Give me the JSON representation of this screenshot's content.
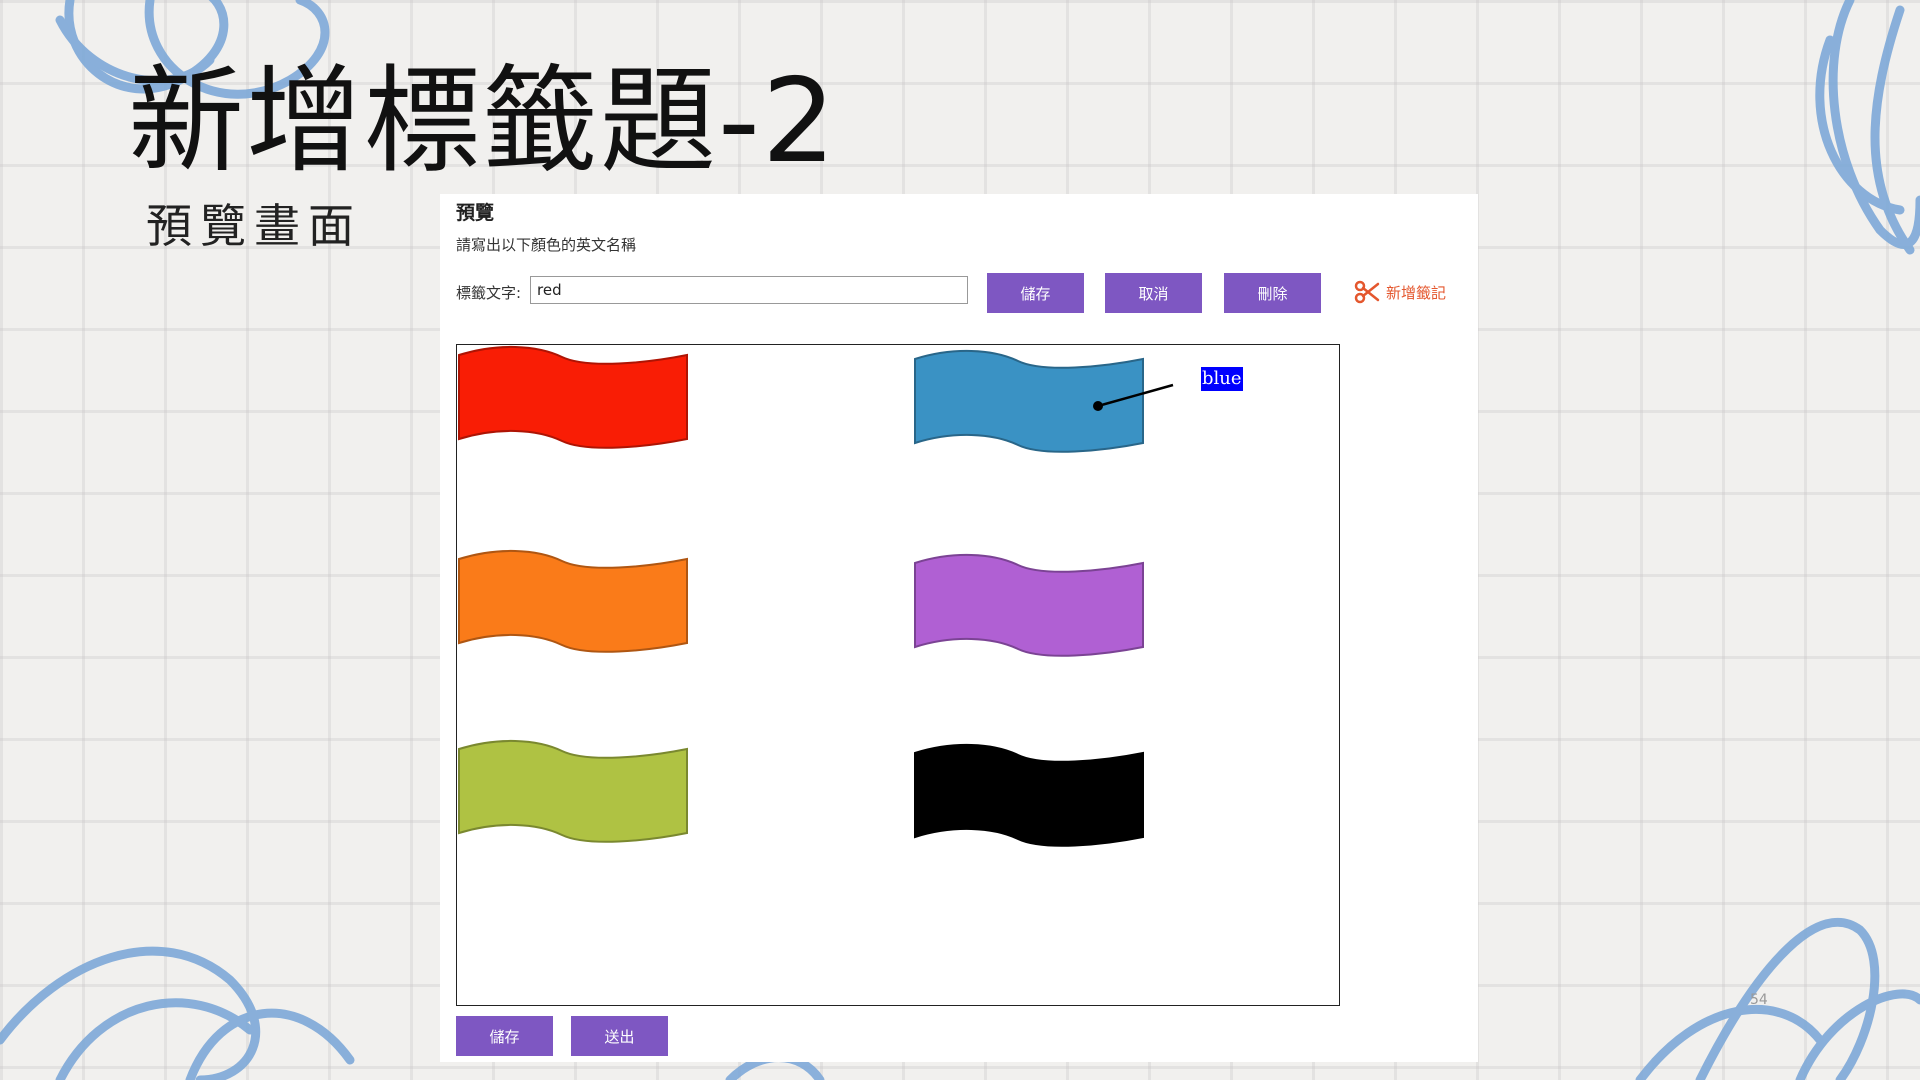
{
  "slide": {
    "title": "新增標籤題-2",
    "subtitle": "預覽畫面",
    "page_number": "54"
  },
  "preview": {
    "title": "預覽",
    "instruction": "請寫出以下顏色的英文名稱",
    "label_caption": "標籤文字:",
    "label_value": "red",
    "buttons": {
      "save": "儲存",
      "cancel": "取消",
      "delete": "刪除"
    },
    "add_note": {
      "label": "新增籤記",
      "icon": "scissors-icon"
    },
    "flags": [
      {
        "color": "#f91d05"
      },
      {
        "color": "#3a92c4"
      },
      {
        "color": "#fa7b19"
      },
      {
        "color": "#b060d3"
      },
      {
        "color": "#afc243"
      },
      {
        "color": "#000000"
      }
    ],
    "tag": {
      "text": "blue",
      "background": "#0000ff"
    },
    "footer_buttons": {
      "save": "儲存",
      "submit": "送出"
    },
    "accent_color": "#7e57c2"
  }
}
